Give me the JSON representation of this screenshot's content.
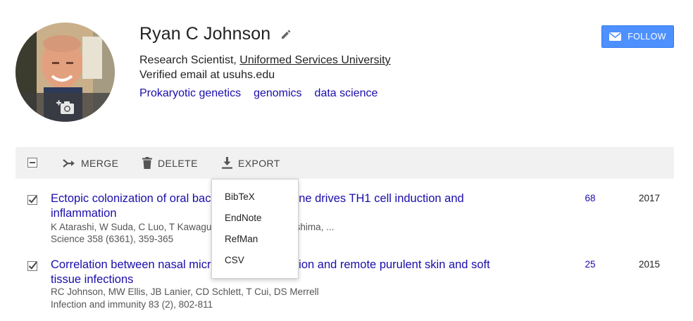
{
  "profile": {
    "name": "Ryan C Johnson",
    "title_prefix": "Research Scientist, ",
    "organization": "Uniformed Services University",
    "email": "Verified email at usuhs.edu",
    "interests": [
      "Prokaryotic genetics",
      "genomics",
      "data science"
    ]
  },
  "follow": {
    "label": "FOLLOW"
  },
  "toolbar": {
    "merge_label": "MERGE",
    "delete_label": "DELETE",
    "export_label": "EXPORT"
  },
  "export_menu": {
    "items": [
      "BibTeX",
      "EndNote",
      "RefMan",
      "CSV"
    ]
  },
  "articles": [
    {
      "title": "Ectopic colonization of oral bacteria in the intestine drives TH1 cell induction and inflammation",
      "authors": "K Atarashi, W Suda, C Luo, T Kawaguchi, I Motoo, S Narushima, ...",
      "venue": "Science 358 (6361), 359-365",
      "cited_by": "68",
      "year": "2017"
    },
    {
      "title": "Correlation between nasal microbiome composition and remote purulent skin and soft tissue infections",
      "authors": "RC Johnson, MW Ellis, JB Lanier, CD Schlett, T Cui, DS Merrell",
      "venue": "Infection and immunity 83 (2), 802-811",
      "cited_by": "25",
      "year": "2015"
    }
  ],
  "colors": {
    "link": "#1a0dab",
    "follow_bg": "#4d90fe",
    "toolbar_bg": "#f1f1f1"
  },
  "icons": [
    "camera-plus-icon",
    "pencil-icon",
    "mail-icon",
    "minus-checkbox-icon",
    "merge-icon",
    "trash-icon",
    "download-icon",
    "checkbox-checked-icon"
  ]
}
